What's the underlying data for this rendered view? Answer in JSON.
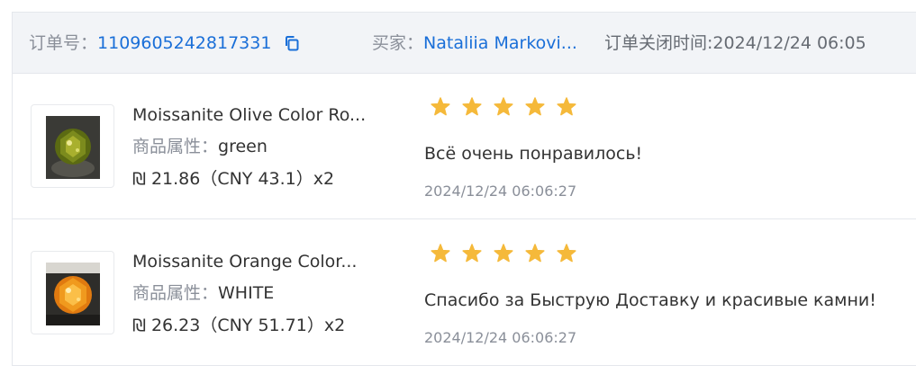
{
  "header": {
    "order_label": "订单号：",
    "order_number": "1109605242817331",
    "buyer_label": "买家：",
    "buyer_name": "Nataliia Markovi...",
    "close_time_text": "订单关闭时间:2024/12/24 06:05"
  },
  "items": [
    {
      "name": "Moissanite Olive Color Ro...",
      "attr_label": "商品属性：",
      "attr_value": "green",
      "price": "₪ 21.86（CNY  43.1）x2",
      "rating": 5,
      "review": "Всё очень понравилось!",
      "review_time": "2024/12/24 06:06:27",
      "gem_color": "#5b6a12"
    },
    {
      "name": "Moissanite Orange Color...",
      "attr_label": "商品属性：",
      "attr_value": "WHITE",
      "price": "₪ 26.23（CNY  51.71）x2",
      "rating": 5,
      "review": "Спасибо за Быструю Доставку и красивые камни!",
      "review_time": "2024/12/24 06:06:27",
      "gem_color": "#e07a10"
    }
  ],
  "colors": {
    "link": "#1a6fd8",
    "star": "#f5b93a",
    "header_bg": "#f2f4f7"
  }
}
